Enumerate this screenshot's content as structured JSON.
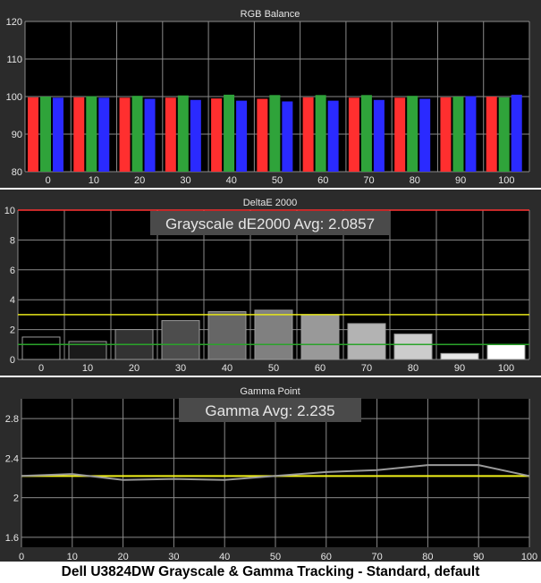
{
  "caption": "Dell U3824DW Grayscale & Gamma Tracking - Standard, default",
  "colors": {
    "panel_bg": "#2b2b2b",
    "plot_bg": "#000000",
    "grid": "#8a8a8a",
    "text": "#e6e6e6",
    "red_bar": "#ff2f2f",
    "green_bar": "#2fa33a",
    "blue_bar": "#2a2aff",
    "limit_red": "#ff3333",
    "limit_yellow": "#e6e619",
    "limit_green": "#2aa32a",
    "gamma_line": "#9a9a9a",
    "gamma_target": "#f2f21a"
  },
  "chart_data": [
    {
      "type": "bar",
      "title": "RGB Balance",
      "categories": [
        "0",
        "10",
        "20",
        "30",
        "40",
        "50",
        "60",
        "70",
        "80",
        "90",
        "100"
      ],
      "series": [
        {
          "color": "red",
          "values": [
            99.8,
            99.8,
            99.7,
            99.7,
            99.5,
            99.4,
            99.8,
            99.7,
            99.7,
            99.8,
            100.0
          ]
        },
        {
          "color": "green",
          "values": [
            100.0,
            100.1,
            100.2,
            100.3,
            100.5,
            100.4,
            100.4,
            100.4,
            100.2,
            100.0,
            99.8
          ]
        },
        {
          "color": "blue",
          "values": [
            99.7,
            99.7,
            99.4,
            99.1,
            98.9,
            98.7,
            98.9,
            99.1,
            99.4,
            100.1,
            100.5
          ]
        }
      ],
      "ylim": [
        80,
        120
      ],
      "yticks": [
        "80",
        "90",
        "100",
        "110",
        "120"
      ],
      "grid": true
    },
    {
      "type": "bar",
      "title": "DeltaE 2000",
      "annotation": "Grayscale dE2000 Avg: 2.0857",
      "categories": [
        "0",
        "10",
        "20",
        "30",
        "40",
        "50",
        "60",
        "70",
        "80",
        "90",
        "100"
      ],
      "values": [
        1.5,
        1.2,
        2.0,
        2.6,
        3.2,
        3.3,
        3.0,
        2.4,
        1.7,
        0.4,
        1.0
      ],
      "ylim": [
        0,
        10
      ],
      "yticks": [
        "0",
        "2",
        "4",
        "6",
        "8",
        "10"
      ],
      "reference_lines": [
        10,
        3,
        1
      ],
      "grid": true
    },
    {
      "type": "line",
      "title": "Gamma Point",
      "annotation": "Gamma Avg: 2.235",
      "x": [
        0,
        10,
        20,
        30,
        40,
        50,
        60,
        70,
        80,
        90,
        100
      ],
      "xticks": [
        "0",
        "10",
        "20",
        "30",
        "40",
        "50",
        "60",
        "70",
        "80",
        "90",
        "100"
      ],
      "series": [
        {
          "values": [
            2.22,
            2.24,
            2.18,
            2.19,
            2.18,
            2.22,
            2.26,
            2.28,
            2.33,
            2.33,
            2.22
          ]
        }
      ],
      "target": 2.22,
      "ylim": [
        1.5,
        3.0
      ],
      "yticks": [
        "1.6",
        "2",
        "2.4",
        "2.8"
      ],
      "grid": true
    }
  ]
}
